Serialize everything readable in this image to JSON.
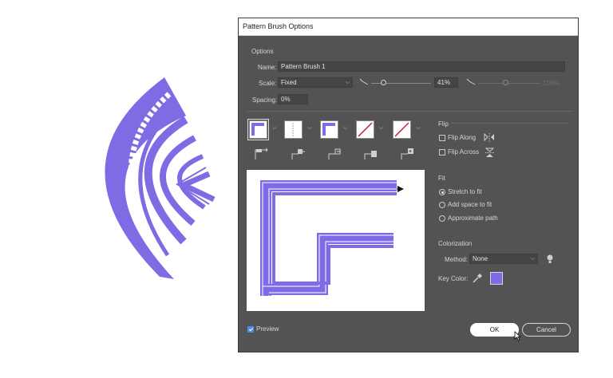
{
  "dialog": {
    "title": "Pattern Brush Options",
    "options_label": "Options",
    "name_label": "Name:",
    "name_value": "Pattern Brush 1",
    "scale_label": "Scale:",
    "scale_value": "Fixed",
    "scale_percent": "41%",
    "scale_percent_max": "100%",
    "spacing_label": "Spacing:",
    "spacing_value": "0%",
    "flip_label": "Flip",
    "flip_along": "Flip Along",
    "flip_across": "Flip Across",
    "fit_label": "Fit",
    "fit_options": [
      "Stretch to fit",
      "Add space to fit",
      "Approximate path"
    ],
    "fit_selected": 0,
    "colorization_label": "Colorization",
    "method_label": "Method:",
    "method_value": "None",
    "key_color_label": "Key Color:",
    "key_color": "#8069e6",
    "preview_label": "Preview",
    "preview_checked": true,
    "ok_label": "OK",
    "cancel_label": "Cancel"
  },
  "colors": {
    "brush": "#7f6be3",
    "dialog_bg": "#535353",
    "accent": "#4a8ee8"
  },
  "icons": [
    "scale-pressure-icon",
    "tile-side-icon",
    "tile-outer-corner-icon",
    "tile-inner-corner-icon",
    "tile-start-icon",
    "tile-end-icon",
    "flip-along-icon",
    "flip-across-icon",
    "tip-icon",
    "eyedropper-icon",
    "cursor-icon"
  ]
}
